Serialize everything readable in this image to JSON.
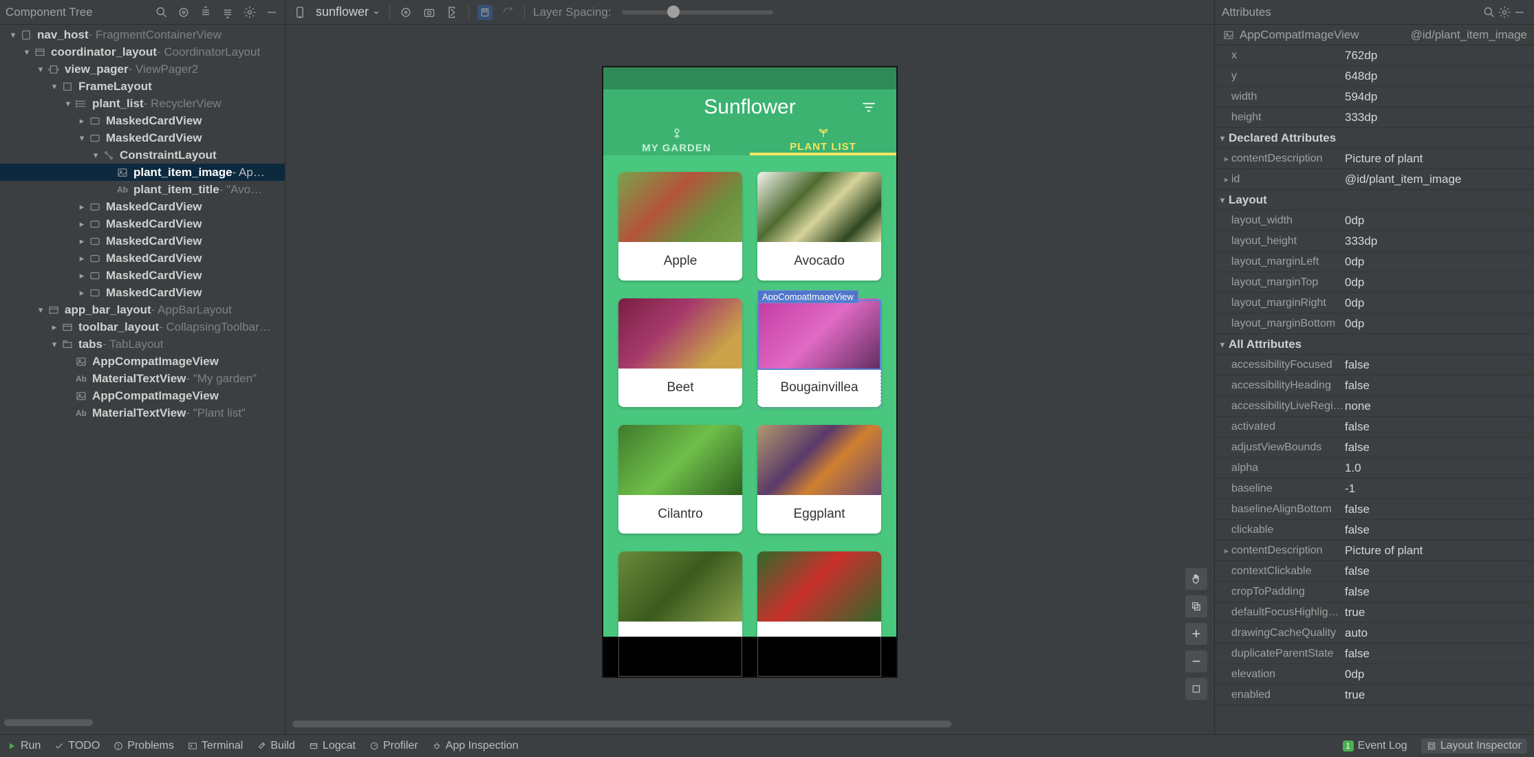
{
  "left_panel": {
    "title": "Component Tree",
    "tree": [
      {
        "depth": 0,
        "toggle": "open",
        "icon": "nav",
        "label": "nav_host",
        "secondary": " - FragmentContainerView"
      },
      {
        "depth": 1,
        "toggle": "open",
        "icon": "container",
        "label": "coordinator_layout",
        "secondary": " - CoordinatorLayout"
      },
      {
        "depth": 2,
        "toggle": "open",
        "icon": "pager",
        "label": "view_pager",
        "secondary": " - ViewPager2"
      },
      {
        "depth": 3,
        "toggle": "open",
        "icon": "frame",
        "label": "FrameLayout",
        "secondary": ""
      },
      {
        "depth": 4,
        "toggle": "open",
        "icon": "list",
        "label": "plant_list",
        "secondary": " - RecyclerView"
      },
      {
        "depth": 5,
        "toggle": "closed",
        "icon": "card",
        "label": "MaskedCardView",
        "secondary": ""
      },
      {
        "depth": 5,
        "toggle": "open",
        "icon": "card",
        "label": "MaskedCardView",
        "secondary": ""
      },
      {
        "depth": 6,
        "toggle": "open",
        "icon": "constraint",
        "label": "ConstraintLayout",
        "secondary": ""
      },
      {
        "depth": 7,
        "toggle": "none",
        "icon": "image",
        "label": "plant_item_image",
        "secondary": " - Ap…",
        "selected": true
      },
      {
        "depth": 7,
        "toggle": "none",
        "icon": "text",
        "label": "plant_item_title",
        "secondary": " - \"Avo…"
      },
      {
        "depth": 5,
        "toggle": "closed",
        "icon": "card",
        "label": "MaskedCardView",
        "secondary": ""
      },
      {
        "depth": 5,
        "toggle": "closed",
        "icon": "card",
        "label": "MaskedCardView",
        "secondary": ""
      },
      {
        "depth": 5,
        "toggle": "closed",
        "icon": "card",
        "label": "MaskedCardView",
        "secondary": ""
      },
      {
        "depth": 5,
        "toggle": "closed",
        "icon": "card",
        "label": "MaskedCardView",
        "secondary": ""
      },
      {
        "depth": 5,
        "toggle": "closed",
        "icon": "card",
        "label": "MaskedCardView",
        "secondary": ""
      },
      {
        "depth": 5,
        "toggle": "closed",
        "icon": "card",
        "label": "MaskedCardView",
        "secondary": ""
      },
      {
        "depth": 2,
        "toggle": "open",
        "icon": "container",
        "label": "app_bar_layout",
        "secondary": " - AppBarLayout"
      },
      {
        "depth": 3,
        "toggle": "closed",
        "icon": "container",
        "label": "toolbar_layout",
        "secondary": " - CollapsingToolbar…"
      },
      {
        "depth": 3,
        "toggle": "open",
        "icon": "tabs",
        "label": "tabs",
        "secondary": " - TabLayout"
      },
      {
        "depth": 4,
        "toggle": "none",
        "icon": "image",
        "label": "AppCompatImageView",
        "secondary": ""
      },
      {
        "depth": 4,
        "toggle": "none",
        "icon": "text",
        "label": "MaterialTextView",
        "secondary": " - \"My garden\""
      },
      {
        "depth": 4,
        "toggle": "none",
        "icon": "image",
        "label": "AppCompatImageView",
        "secondary": ""
      },
      {
        "depth": 4,
        "toggle": "none",
        "icon": "text",
        "label": "MaterialTextView",
        "secondary": " - \"Plant list\""
      }
    ]
  },
  "center": {
    "device_name": "sunflower",
    "spacing_label": "Layer Spacing:",
    "selection_tag": "AppCompatImageView",
    "app_title": "Sunflower",
    "tabs": {
      "garden": "MY GARDEN",
      "plantlist": "PLANT LIST"
    },
    "cards": [
      {
        "title": "Apple",
        "img": "img-apple"
      },
      {
        "title": "Avocado",
        "img": "img-avocado"
      },
      {
        "title": "Beet",
        "img": "img-beet"
      },
      {
        "title": "Bougainvillea",
        "img": "img-boug"
      },
      {
        "title": "Cilantro",
        "img": "img-cilantro"
      },
      {
        "title": "Eggplant",
        "img": "img-eggplant"
      },
      {
        "title": "",
        "img": "img-grape"
      },
      {
        "title": "",
        "img": "img-hibiscus"
      }
    ]
  },
  "right_panel": {
    "title": "Attributes",
    "selection": {
      "type": "AppCompatImageView",
      "id": "@id/plant_item_image"
    },
    "basics": [
      {
        "k": "x",
        "v": "762dp"
      },
      {
        "k": "y",
        "v": "648dp"
      },
      {
        "k": "width",
        "v": "594dp"
      },
      {
        "k": "height",
        "v": "333dp"
      }
    ],
    "sections": [
      {
        "name": "Declared Attributes",
        "rows": [
          {
            "k": "contentDescription",
            "v": "Picture of plant",
            "expand": true
          },
          {
            "k": "id",
            "v": "@id/plant_item_image",
            "expand": true
          }
        ]
      },
      {
        "name": "Layout",
        "rows": [
          {
            "k": "layout_width",
            "v": "0dp"
          },
          {
            "k": "layout_height",
            "v": "333dp"
          },
          {
            "k": "layout_marginLeft",
            "v": "0dp"
          },
          {
            "k": "layout_marginTop",
            "v": "0dp"
          },
          {
            "k": "layout_marginRight",
            "v": "0dp"
          },
          {
            "k": "layout_marginBottom",
            "v": "0dp"
          }
        ]
      },
      {
        "name": "All Attributes",
        "rows": [
          {
            "k": "accessibilityFocused",
            "v": "false"
          },
          {
            "k": "accessibilityHeading",
            "v": "false"
          },
          {
            "k": "accessibilityLiveRegion",
            "v": "none"
          },
          {
            "k": "activated",
            "v": "false"
          },
          {
            "k": "adjustViewBounds",
            "v": "false"
          },
          {
            "k": "alpha",
            "v": "1.0"
          },
          {
            "k": "baseline",
            "v": "-1"
          },
          {
            "k": "baselineAlignBottom",
            "v": "false"
          },
          {
            "k": "clickable",
            "v": "false"
          },
          {
            "k": "contentDescription",
            "v": "Picture of plant",
            "expand": true
          },
          {
            "k": "contextClickable",
            "v": "false"
          },
          {
            "k": "cropToPadding",
            "v": "false"
          },
          {
            "k": "defaultFocusHighlight…",
            "v": "true"
          },
          {
            "k": "drawingCacheQuality",
            "v": "auto"
          },
          {
            "k": "duplicateParentState",
            "v": "false"
          },
          {
            "k": "elevation",
            "v": "0dp"
          },
          {
            "k": "enabled",
            "v": "true"
          }
        ]
      }
    ]
  },
  "bottom": {
    "items": [
      "Run",
      "TODO",
      "Problems",
      "Terminal",
      "Build",
      "Logcat",
      "Profiler",
      "App Inspection"
    ],
    "event_log": "Event Log",
    "layout_inspector": "Layout Inspector",
    "event_count": "1"
  }
}
